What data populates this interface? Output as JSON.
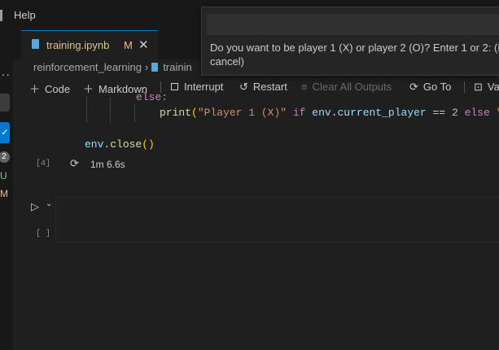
{
  "menubar": {
    "help_label": "Help"
  },
  "activity": {
    "check_glyph": "✓",
    "badge_count": "2",
    "git_untracked": "U",
    "git_modified": "M"
  },
  "tab": {
    "filename": "training.ipynb",
    "modified_marker": "M",
    "close_glyph": "✕"
  },
  "breadcrumb": {
    "folder": "reinforcement_learning",
    "file": "trainin"
  },
  "toolbar": {
    "code": "Code",
    "markdown": "Markdown",
    "interrupt": "Interrupt",
    "restart": "Restart",
    "clear_all_outputs": "Clear All Outputs",
    "go_to": "Go To",
    "variables": "Va"
  },
  "code": {
    "else_line": "else:",
    "print_fn": "print",
    "print_str": "\"Player 1 (X)\"",
    "print_if": "if",
    "print_env": "env",
    "print_attr": "current_player",
    "print_eq": "==",
    "print_num": "2",
    "print_else": "else",
    "print_tail": "\"",
    "close_obj": "env",
    "close_fn": "close"
  },
  "cell1": {
    "exec_count": "[4]",
    "duration": "1m 6.6s"
  },
  "cell2": {
    "exec_count": "[ ]"
  },
  "dialog": {
    "input_value": "",
    "prompt_line1": "Do you want to be player 1 (X) or player 2 (O)? Enter 1 or 2: (P",
    "prompt_line2": "cancel)"
  },
  "colors": {
    "accent": "#0078d4",
    "modified": "#e2c08d",
    "untracked": "#73c991"
  }
}
